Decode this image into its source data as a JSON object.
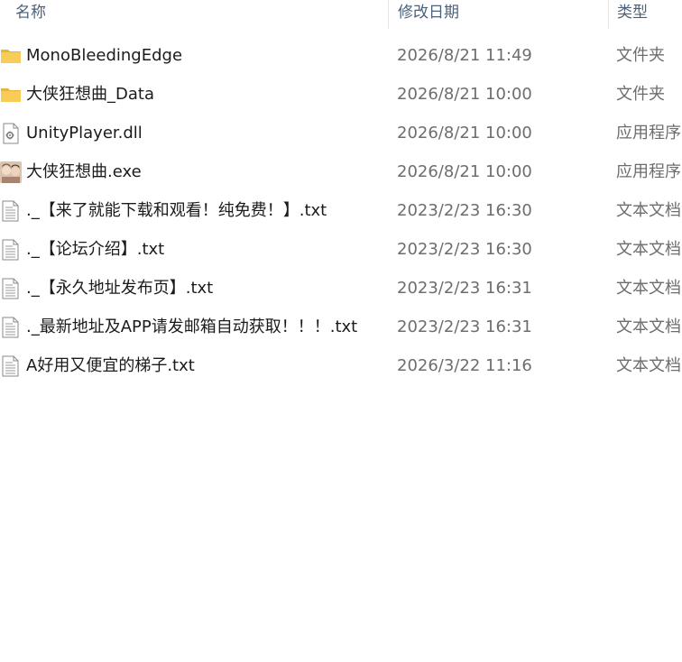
{
  "columns": {
    "name": "名称",
    "date": "修改日期",
    "type": "类型"
  },
  "files": [
    {
      "name": "MonoBleedingEdge",
      "date": "2026/8/21 11:49",
      "type": "文件夹",
      "icon": "folder-icon"
    },
    {
      "name": "大侠狂想曲_Data",
      "date": "2026/8/21 10:00",
      "type": "文件夹",
      "icon": "folder-icon"
    },
    {
      "name": "UnityPlayer.dll",
      "date": "2026/8/21 10:00",
      "type": "应用程序",
      "icon": "dll-file-icon"
    },
    {
      "name": "大侠狂想曲.exe",
      "date": "2026/8/21 10:00",
      "type": "应用程序",
      "icon": "app-icon"
    },
    {
      "name": "._【来了就能下载和观看！纯免费！】.txt",
      "date": "2023/2/23 16:30",
      "type": "文本文档",
      "icon": "text-file-icon"
    },
    {
      "name": "._【论坛介绍】.txt",
      "date": "2023/2/23 16:30",
      "type": "文本文档",
      "icon": "text-file-icon"
    },
    {
      "name": "._【永久地址发布页】.txt",
      "date": "2023/2/23 16:31",
      "type": "文本文档",
      "icon": "text-file-icon"
    },
    {
      "name": "._最新地址及APP请发邮箱自动获取！！！.txt",
      "date": "2023/2/23 16:31",
      "type": "文本文档",
      "icon": "text-file-icon"
    },
    {
      "name": "A好用又便宜的梯子.txt",
      "date": "2026/3/22 11:16",
      "type": "文本文档",
      "icon": "text-file-icon"
    }
  ],
  "colors": {
    "folder": "#f6c74e",
    "header_text": "#4c607a",
    "name_text": "#1b1b1b",
    "meta_text": "#6d6d6d"
  }
}
